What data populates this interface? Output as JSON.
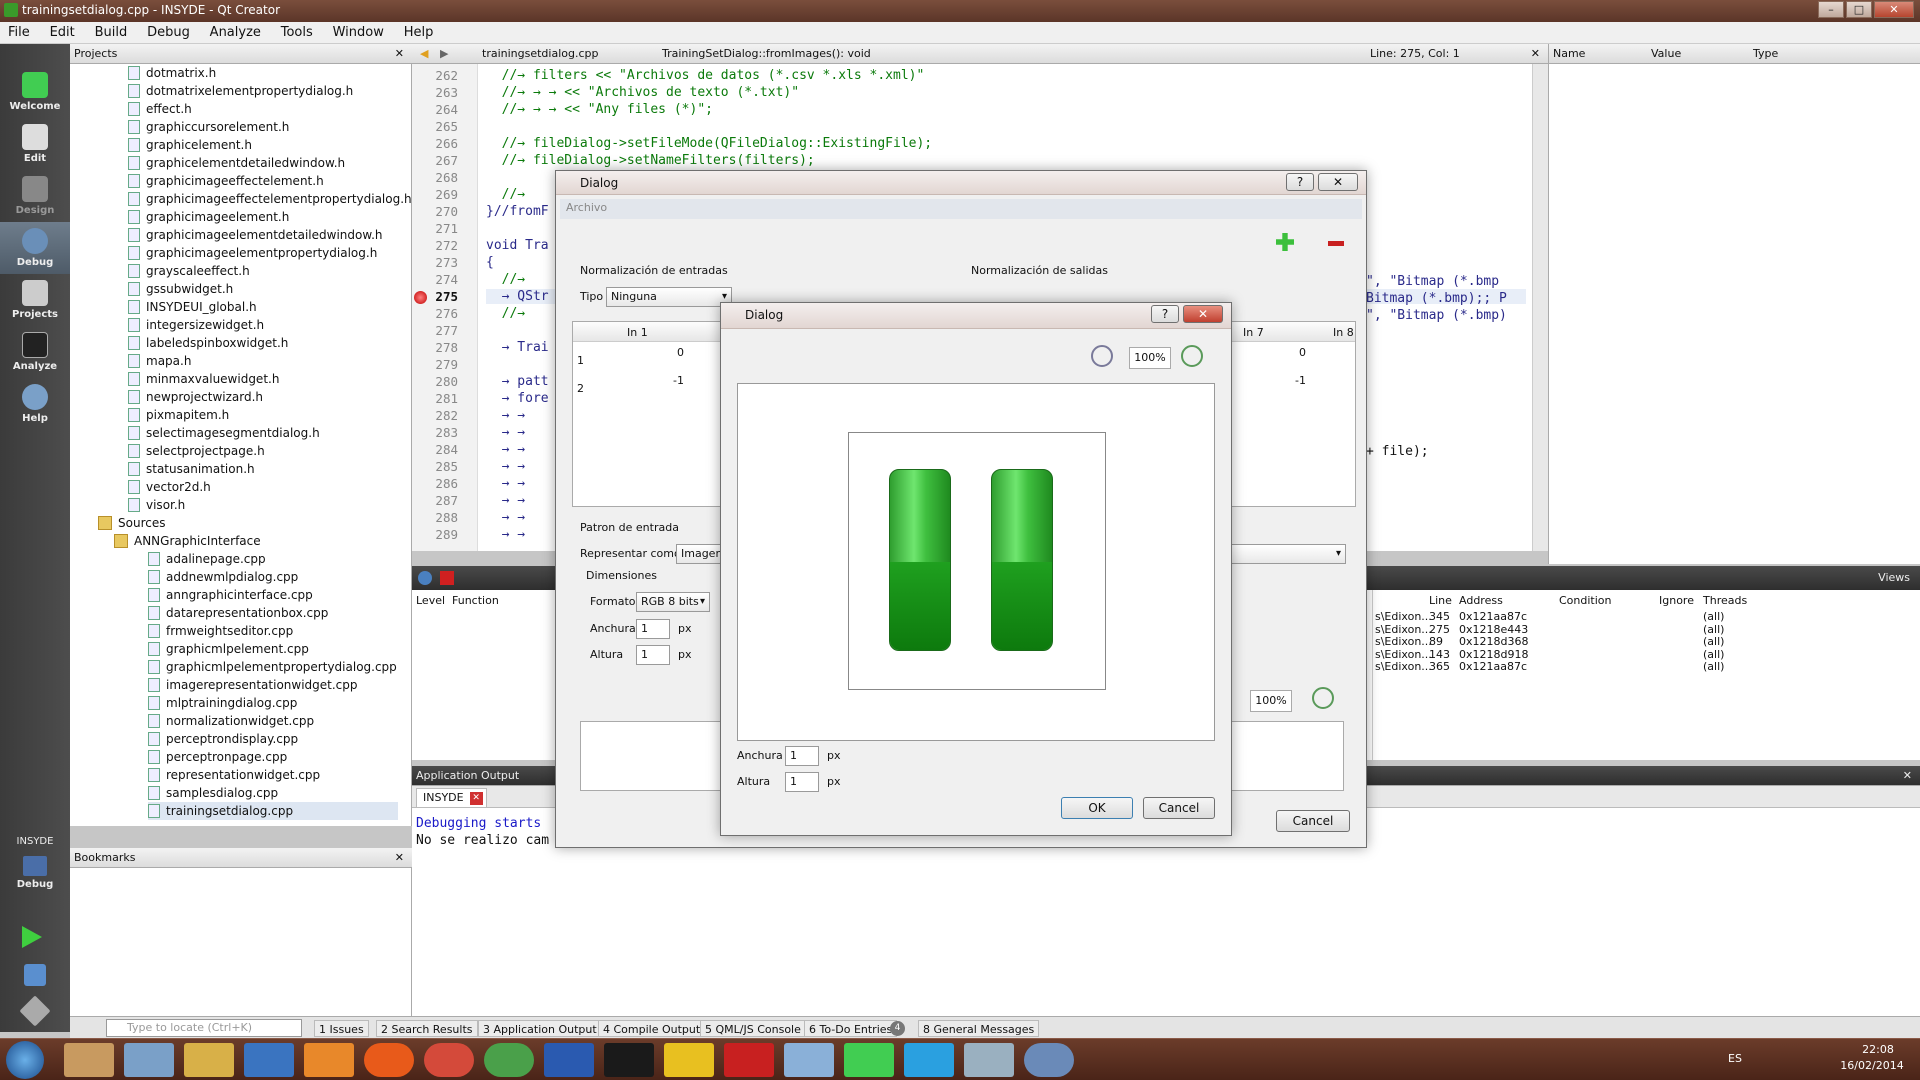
{
  "window": {
    "title": "trainingsetdialog.cpp - INSYDE - Qt Creator",
    "minimize": "–",
    "maximize": "□",
    "close": "✕"
  },
  "menu": [
    "File",
    "Edit",
    "Build",
    "Debug",
    "Analyze",
    "Tools",
    "Window",
    "Help"
  ],
  "modes": [
    {
      "label": "Welcome",
      "icon": "qt-logo-icon"
    },
    {
      "label": "Edit",
      "icon": "edit-icon"
    },
    {
      "label": "Design",
      "icon": "design-icon"
    },
    {
      "label": "Debug",
      "icon": "debug-icon"
    },
    {
      "label": "Projects",
      "icon": "projects-icon"
    },
    {
      "label": "Analyze",
      "icon": "analyze-icon"
    },
    {
      "label": "Help",
      "icon": "help-icon"
    }
  ],
  "kit": {
    "project": "INSYDE",
    "config": "Debug"
  },
  "projects_panel": {
    "title": "Projects",
    "headers": [
      "dotmatrix.h",
      "dotmatrixelementpropertydialog.h",
      "effect.h",
      "graphiccursorelement.h",
      "graphicelement.h",
      "graphicelementdetailedwindow.h",
      "graphicimageeffectelement.h",
      "graphicimageeffectelementpropertydialog.h",
      "graphicimageelement.h",
      "graphicimageelementdetailedwindow.h",
      "graphicimageelementpropertydialog.h",
      "grayscaleeffect.h",
      "gssubwidget.h",
      "INSYDEUI_global.h",
      "integersizewidget.h",
      "labeledspinboxwidget.h",
      "mapa.h",
      "minmaxvaluewidget.h",
      "newprojectwizard.h",
      "pixmapitem.h",
      "selectimagesegmentdialog.h",
      "selectprojectpage.h",
      "statusanimation.h",
      "vector2d.h",
      "visor.h"
    ],
    "sources_folder": "Sources",
    "subfolder": "ANNGraphicInterface",
    "sources": [
      "adalinepage.cpp",
      "addnewmlpdialog.cpp",
      "anngraphicinterface.cpp",
      "datarepresentationbox.cpp",
      "frmweightseditor.cpp",
      "graphicmlpelement.cpp",
      "graphicmlpelementpropertydialog.cpp",
      "imagerepresentationwidget.cpp",
      "mlptrainingdialog.cpp",
      "normalizationwidget.cpp",
      "perceptrondisplay.cpp",
      "perceptronpage.cpp",
      "representationwidget.cpp",
      "samplesdialog.cpp",
      "trainingsetdialog.cpp"
    ]
  },
  "bookmarks_panel": {
    "title": "Bookmarks"
  },
  "editor": {
    "file_tab": "trainingsetdialog.cpp",
    "symbol": "TrainingSetDialog::fromImages(): void",
    "position": "Line: 275, Col: 1",
    "line_numbers": [
      "262",
      "263",
      "264",
      "265",
      "266",
      "267",
      "268",
      "269",
      "270",
      "271",
      "272",
      "273",
      "274",
      "275",
      "276",
      "277",
      "278",
      "279",
      "280",
      "281",
      "282",
      "283",
      "284",
      "285",
      "286",
      "287",
      "288",
      "289"
    ],
    "lines": [
      {
        "text": "  //→ filters << \"Archivos de datos (*.csv *.xls *.xml)\"",
        "g": true
      },
      {
        "text": "  //→ → → << \"Archivos de texto (*.txt)\"",
        "g": true
      },
      {
        "text": "  //→ → → << \"Any files (*)\";",
        "g": true
      },
      {
        "text": "",
        "g": false
      },
      {
        "text": "  //→ fileDialog->setFileMode(QFileDialog::ExistingFile);",
        "g": true
      },
      {
        "text": "  //→ fileDialog->setNameFilters(filters);",
        "g": true
      },
      {
        "text": "",
        "g": false
      },
      {
        "text": "  //→",
        "g": true
      },
      {
        "text": "}//fromF",
        "g": false
      },
      {
        "text": "",
        "g": false
      },
      {
        "text": "void Tra",
        "g": false
      },
      {
        "text": "{",
        "g": false
      },
      {
        "text": "  //→",
        "g": true
      },
      {
        "text": "  → QStr",
        "g": false
      },
      {
        "text": "  //→",
        "g": true
      },
      {
        "text": "",
        "g": false
      },
      {
        "text": "  → Trai",
        "g": false
      },
      {
        "text": "",
        "g": false
      },
      {
        "text": "  → patt",
        "g": false
      },
      {
        "text": "  → fore",
        "g": false
      },
      {
        "text": "  → →",
        "g": false
      },
      {
        "text": "  → →",
        "g": false
      },
      {
        "text": "  → →",
        "g": false
      },
      {
        "text": "  → →",
        "g": false
      },
      {
        "text": "  → →",
        "g": false
      },
      {
        "text": "  → →",
        "g": false
      },
      {
        "text": "  → →",
        "g": false
      },
      {
        "text": "  → →",
        "g": false
      }
    ],
    "right_fragments": [
      "\", \"Bitmap (*.bmp",
      "Bitmap (*.bmp);; P",
      "\", \"Bitmap (*.bmp)",
      "+ file);"
    ]
  },
  "locals_panel": {
    "columns": [
      "Name",
      "Value",
      "Type"
    ]
  },
  "debugger": {
    "stack_columns": [
      "Level",
      "Function"
    ],
    "views_label": "Views",
    "bp_columns": [
      "Line",
      "Address",
      "Condition",
      "Ignore",
      "Threads"
    ],
    "breakpoints": [
      {
        "file": "s\\Edixon...",
        "line": "345",
        "addr": "0x121aa87c",
        "threads": "(all)"
      },
      {
        "file": "s\\Edixon...",
        "line": "275",
        "addr": "0x1218e443",
        "threads": "(all)"
      },
      {
        "file": "s\\Edixon...",
        "line": "89",
        "addr": "0x1218d368",
        "threads": "(all)"
      },
      {
        "file": "s\\Edixon...",
        "line": "143",
        "addr": "0x1218d918",
        "threads": "(all)"
      },
      {
        "file": "s\\Edixon...",
        "line": "365",
        "addr": "0x121aa87c",
        "threads": "(all)"
      }
    ]
  },
  "app_output": {
    "title": "Application Output",
    "tab": "INSYDE",
    "lines": [
      "Debugging starts",
      "No se realizo cam"
    ]
  },
  "statusbar": {
    "locate_placeholder": "Type to locate (Ctrl+K)",
    "tabs": [
      "1 Issues",
      "2 Search Results",
      "3 Application Output",
      "4 Compile Output",
      "5 QML/JS Console",
      "6 To-Do Entries",
      "8 General Messages"
    ],
    "todo_badge": "4"
  },
  "dialog_back": {
    "title": "Dialog",
    "group": "Archivo",
    "norm_in_label": "Normalización de entradas",
    "norm_out_label": "Normalización de salidas",
    "tipo_label": "Tipo",
    "tipo_value": "Ninguna",
    "table_headers": [
      "In 1",
      "In 7",
      "In 8"
    ],
    "rows": [
      {
        "n": "1",
        "v1": "0",
        "v8": "0"
      },
      {
        "n": "2",
        "v1": "-1",
        "v8": "-1"
      }
    ],
    "patron_label": "Patron de entrada",
    "represent_label": "Representar como",
    "represent_value": "Imagen",
    "dimensiones_label": "Dimensiones",
    "formato_label": "Formato",
    "formato_value": "RGB 8 bits",
    "anchura_label": "Anchura",
    "altura_label": "Altura",
    "spin_value": "1",
    "px": "px",
    "zoom": "100%",
    "cancel": "Cancel",
    "help_btn": "?",
    "close_btn": "✕"
  },
  "dialog_front": {
    "title": "Dialog",
    "zoom": "100%",
    "anchura_label": "Anchura",
    "altura_label": "Altura",
    "spin_value": "1",
    "px": "px",
    "ok": "OK",
    "cancel": "Cancel",
    "help_btn": "?",
    "close_btn": "✕"
  },
  "taskbar": {
    "lang": "ES",
    "time": "22:08",
    "date": "16/02/2014"
  }
}
